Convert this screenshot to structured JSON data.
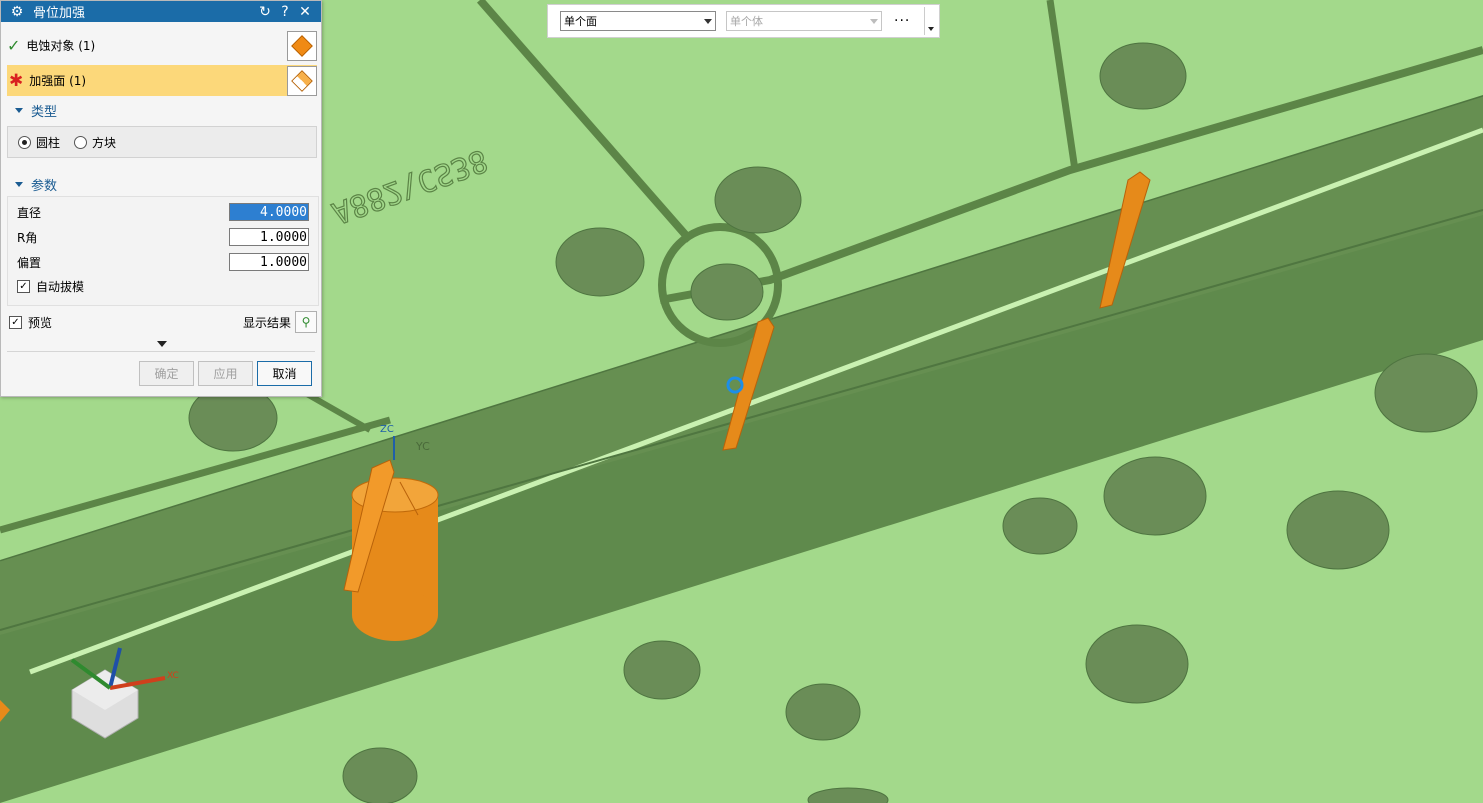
{
  "dialog": {
    "title": "骨位加强",
    "icons": [
      "settings-icon",
      "reset-icon",
      "help-icon",
      "close-icon"
    ],
    "select_object": {
      "label": "电蚀对象 (1)",
      "status_icon": "check-icon"
    },
    "reinforce_face": {
      "label": "加强面 (1)",
      "status_icon": "required-asterisk-icon"
    },
    "type_section": {
      "title": "类型",
      "options": [
        "圆柱",
        "方块"
      ],
      "selected": "圆柱"
    },
    "params_section": {
      "title": "参数",
      "diameter": {
        "label": "直径",
        "value": "4.0000"
      },
      "r_angle": {
        "label": "R角",
        "value": "1.0000"
      },
      "offset": {
        "label": "偏置",
        "value": "1.0000"
      },
      "auto_draft": {
        "label": "自动拔模",
        "checked": true
      }
    },
    "preview": {
      "label": "预览",
      "checked": true,
      "show_result": "显示结果"
    },
    "buttons": {
      "ok": "确定",
      "apply": "应用",
      "cancel": "取消"
    }
  },
  "topbar": {
    "filter1": "单个面",
    "filter2": "单个体",
    "more": "···"
  },
  "viewport": {
    "axis_labels": {
      "zc": "ZC",
      "yc": "YC",
      "xc": "XC"
    },
    "colors": {
      "face_light": "#a3d98b",
      "face_dark": "#5f8a4c",
      "hole": "#6a8d57",
      "rib": "#e68a1a",
      "accent": "#1b6ca8"
    }
  }
}
